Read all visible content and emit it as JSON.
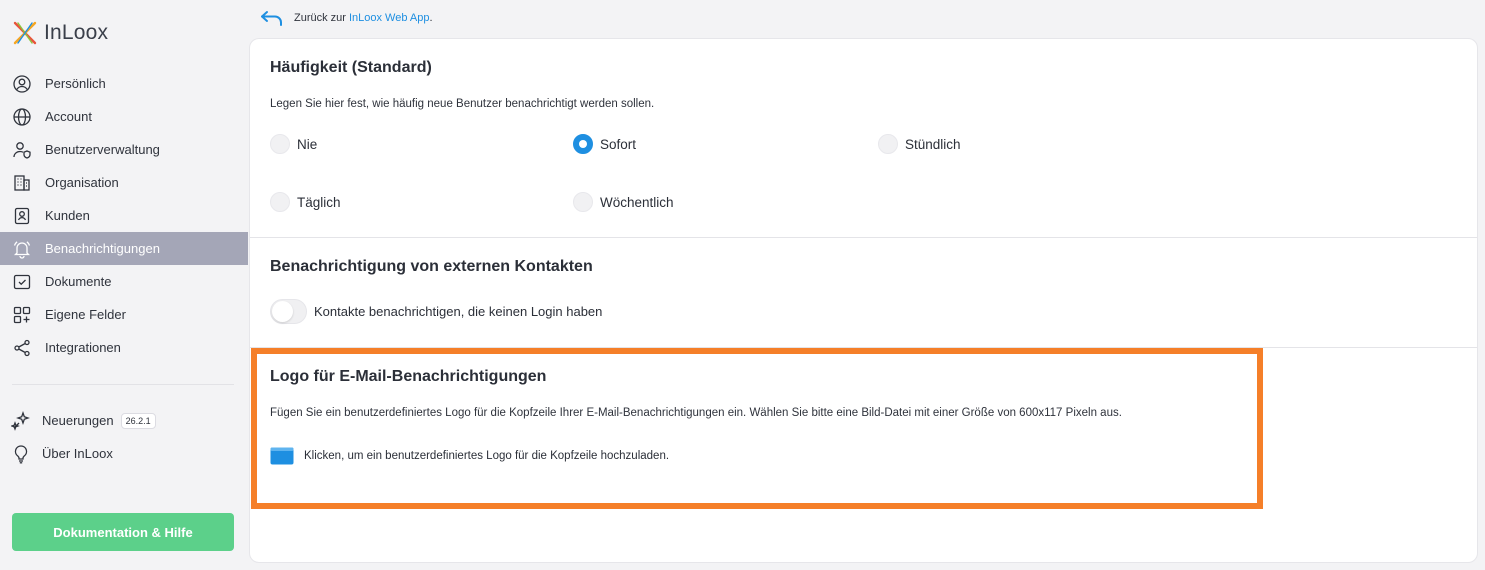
{
  "app": {
    "logo_text": "InLoox"
  },
  "sidebar": {
    "items": [
      {
        "label": "Persönlich",
        "icon": "user-circle-icon"
      },
      {
        "label": "Account",
        "icon": "globe-icon"
      },
      {
        "label": "Benutzerverwaltung",
        "icon": "users-shield-icon"
      },
      {
        "label": "Organisation",
        "icon": "building-icon"
      },
      {
        "label": "Kunden",
        "icon": "contact-book-icon"
      },
      {
        "label": "Benachrichtigungen",
        "icon": "bell-icon",
        "active": true
      },
      {
        "label": "Dokumente",
        "icon": "folder-check-icon"
      },
      {
        "label": "Eigene Felder",
        "icon": "grid-plus-icon"
      },
      {
        "label": "Integrationen",
        "icon": "share-nodes-icon"
      }
    ],
    "secondary": [
      {
        "label": "Neuerungen",
        "icon": "sparkle-icon",
        "badge": "26.2.1"
      },
      {
        "label": "Über InLoox",
        "icon": "lightbulb-icon"
      }
    ],
    "help_button": "Dokumentation & Hilfe"
  },
  "header": {
    "back_prefix": "Zurück zur",
    "back_link": "InLoox Web App",
    "back_suffix": "."
  },
  "frequency": {
    "title": "Häufigkeit (Standard)",
    "description": "Legen Sie hier fest, wie häufig neue Benutzer benachrichtigt werden sollen.",
    "options": [
      "Nie",
      "Sofort",
      "Stündlich",
      "Täglich",
      "Wöchentlich"
    ],
    "selected": "Sofort"
  },
  "external": {
    "title": "Benachrichtigung von externen Kontakten",
    "toggle_label": "Kontakte benachrichtigen, die keinen Login haben",
    "toggle_on": false
  },
  "logo_section": {
    "title": "Logo für E-Mail-Benachrichtigungen",
    "description": "Fügen Sie ein benutzerdefiniertes Logo für die Kopfzeile Ihrer E-Mail-Benachrichtigungen ein. Wählen Sie bitte eine Bild-Datei mit einer Größe von 600x117 Pixeln aus.",
    "upload_label": "Klicken, um ein benutzerdefiniertes Logo für die Kopfzeile hochzuladen."
  },
  "colors": {
    "accent": "#1e8fe1",
    "active_nav": "#a4a6b7",
    "help_button": "#5cd08a",
    "highlight": "#f57f29"
  }
}
